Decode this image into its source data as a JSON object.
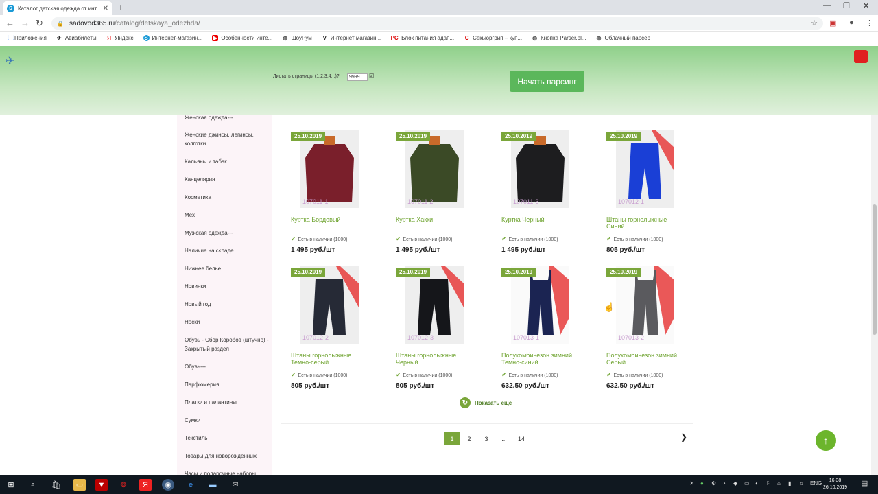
{
  "browser": {
    "tab_title": "Каталог детская одежда от инт",
    "url_host": "sadovod365.ru",
    "url_path": "/catalog/detskaya_odezhda/",
    "bookmarks": [
      "Приложения",
      "Авиабилеты",
      "Яндекс",
      "Интернет-магазин...",
      "Особенности инте...",
      "ШоуРум",
      "Интернет магазин...",
      "Блок питания адап...",
      "Секьюргрип – куп...",
      "Кнопка Parser.pl...",
      "Облачный парсер"
    ]
  },
  "plugin": {
    "pages_label": "Листать страницы (1,2,3,4...)?",
    "pages_value": "9999",
    "start_button": "Начать парсинг"
  },
  "sidebar": {
    "items": [
      "Женская одежда---",
      "Женские джинсы, легинсы, колготки",
      "Кальяны и табак",
      "Канцелярия",
      "Косметика",
      "Мех",
      "Мужская одежда---",
      "Наличие на складе",
      "Нижнее белье",
      "Новинки",
      "Новый год",
      "Носки",
      "Обувь - Сбор Коробов (штучно) - Закрытый раздел",
      "Обувь---",
      "Парфюмерия",
      "Платки и палантины",
      "Сумки",
      "Текстиль",
      "Товары для новорожденных",
      "Часы и подарочные наборы"
    ]
  },
  "products": [
    {
      "date": "25.10.2019",
      "code": "107011-1",
      "name": "Куртка Бордовый",
      "stock": "Есть в наличии (1000)",
      "price": "1 495 руб./шт",
      "color": "#7a1f2b"
    },
    {
      "date": "25.10.2019",
      "code": "107011-2",
      "name": "Куртка Хакки",
      "stock": "Есть в наличии (1000)",
      "price": "1 495 руб./шт",
      "color": "#3b4a26"
    },
    {
      "date": "25.10.2019",
      "code": "107011-3",
      "name": "Куртка Черный",
      "stock": "Есть в наличии (1000)",
      "price": "1 495 руб./шт",
      "color": "#1d1d1f"
    },
    {
      "date": "25.10.2019",
      "code": "107012-1",
      "name": "Штаны горнолыжные Синий",
      "stock": "Есть в наличии (1000)",
      "price": "805 руб./шт",
      "color": "#1a3fd6"
    },
    {
      "date": "25.10.2019",
      "code": "107012-2",
      "name": "Штаны горнолыжные Темно-серый",
      "stock": "Есть в наличии (1000)",
      "price": "805 руб./шт",
      "color": "#262a36"
    },
    {
      "date": "25.10.2019",
      "code": "107012-3",
      "name": "Штаны горнолыжные Черный",
      "stock": "Есть в наличии (1000)",
      "price": "805 руб./шт",
      "color": "#15161a"
    },
    {
      "date": "25.10.2019",
      "code": "107013-1",
      "name": "Полукомбинезон зимний Темно-синий",
      "stock": "Есть в наличии (1000)",
      "price": "632.50 руб./шт",
      "color": "#1b2452"
    },
    {
      "date": "25.10.2019",
      "code": "107013-2",
      "name": "Полукомбинезон зимний Серый",
      "stock": "Есть в наличии (1000)",
      "price": "632.50 руб./шт",
      "color": "#5a5a5e"
    }
  ],
  "show_more": "Показать еще",
  "pagination": [
    "1",
    "2",
    "3",
    "...",
    "14"
  ],
  "taskbar": {
    "lang": "ENG",
    "time": "16:38",
    "date": "26.10.2019"
  }
}
